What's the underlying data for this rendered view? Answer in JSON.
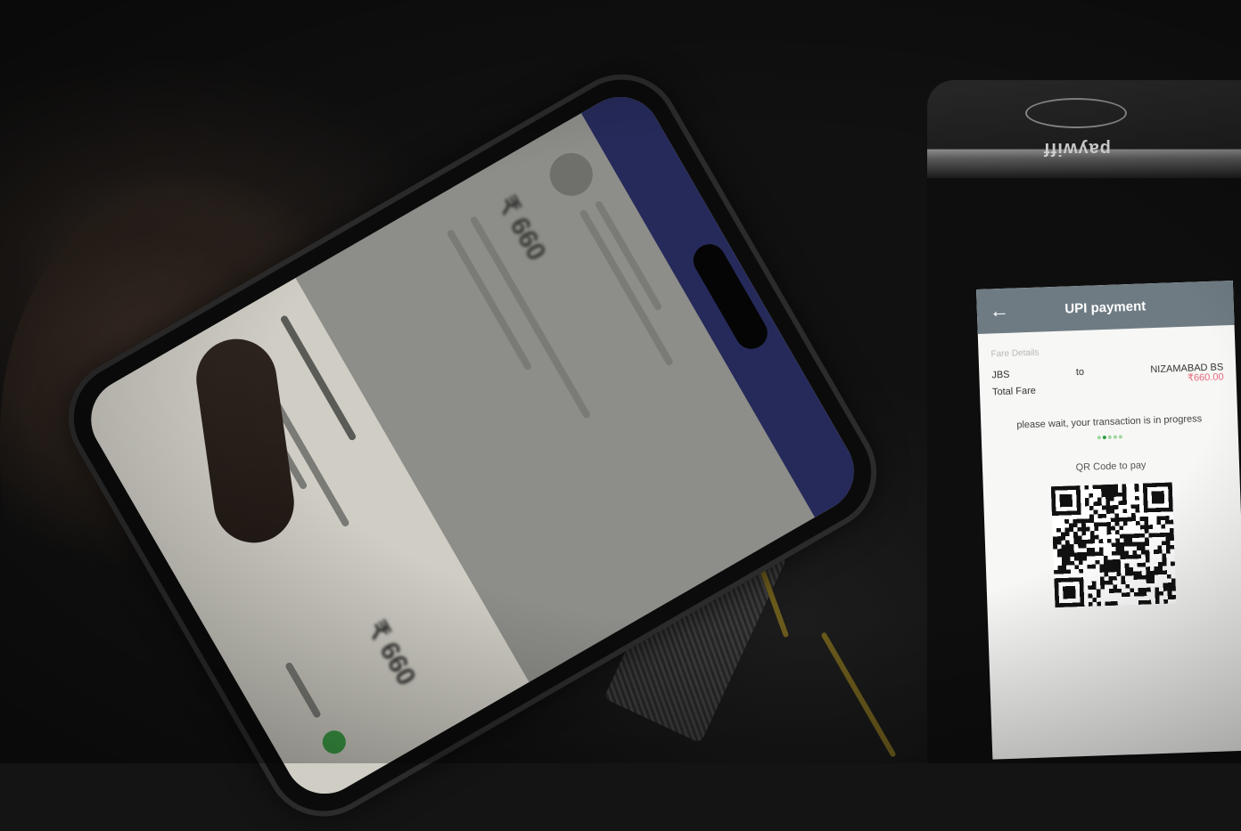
{
  "terminal": {
    "brand": "paywiff",
    "screen": {
      "title": "UPI payment",
      "back_icon": "arrow-left-icon",
      "section_label": "Fare Details",
      "from": "JBS",
      "to_label": "to",
      "destination": "NIZAMABAD BS",
      "fare": "₹660.00",
      "total_label": "Total Fare",
      "status": "please wait, your transaction is in progress",
      "qr_label": "QR Code to pay"
    }
  },
  "phone": {
    "amount_top": "₹ 660",
    "amount_bottom": "₹ 660"
  },
  "colors": {
    "terminal_header": "#6e7b83",
    "fare_text": "#e9677c",
    "phone_header": "#262a5a",
    "progress_dot": "#2e9b3e"
  }
}
